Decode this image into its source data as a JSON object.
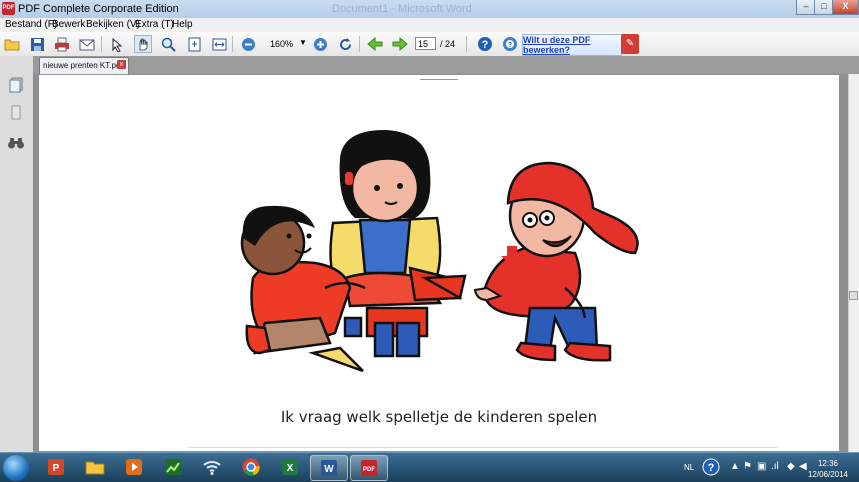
{
  "window": {
    "title": "PDF Complete Corporate Edition",
    "doc_title_faded": "Document1 - Microsoft Word",
    "minimize": "–",
    "maximize": "□",
    "close": "X",
    "app_icon": "PDF"
  },
  "menu": [
    "Bestand (F)",
    "Bewerk",
    "Bekijken (V)",
    "Extra (T)",
    "Help"
  ],
  "toolbar": {
    "zoom": "160%",
    "zoom_dropdown": "▼",
    "page_current": "15",
    "page_total": "/ 24",
    "edit_banner": "Wilt u deze PDF bewerken?",
    "edit_icon": "✎",
    "icons": {
      "open": "folder-open-icon",
      "save": "save-icon",
      "print": "print-icon",
      "mail": "mail-icon",
      "select": "select-icon",
      "hand": "hand-icon",
      "zoom": "zoom-icon",
      "fit_page": "fit-page-icon",
      "fit_width": "fit-width-icon",
      "zoom_out": "zoom-out-icon",
      "zoom_in": "zoom-in-icon",
      "rotate": "rotate-icon",
      "prev": "arrow-left-icon",
      "next": "arrow-right-icon",
      "help": "help-icon",
      "help2": "help-globe-icon"
    }
  },
  "tab": {
    "label": "nieuwe prenten KT.pdf",
    "close": "x"
  },
  "page": {
    "caption": "Ik vraag welk spelletje de kinderen spelen"
  },
  "taskbar": {
    "language": "NL",
    "time": "12:36",
    "date": "12/06/2014",
    "apps": [
      "powerpoint-icon",
      "file-explorer-icon",
      "media-player-icon",
      "chart-app-icon",
      "wifi-icon",
      "chrome-icon",
      "excel-icon",
      "word-icon",
      "pdf-complete-icon"
    ]
  },
  "colors": {
    "accent": "#c4262e",
    "taskbar": "#1a3f5c",
    "link": "#1f3fbf"
  }
}
